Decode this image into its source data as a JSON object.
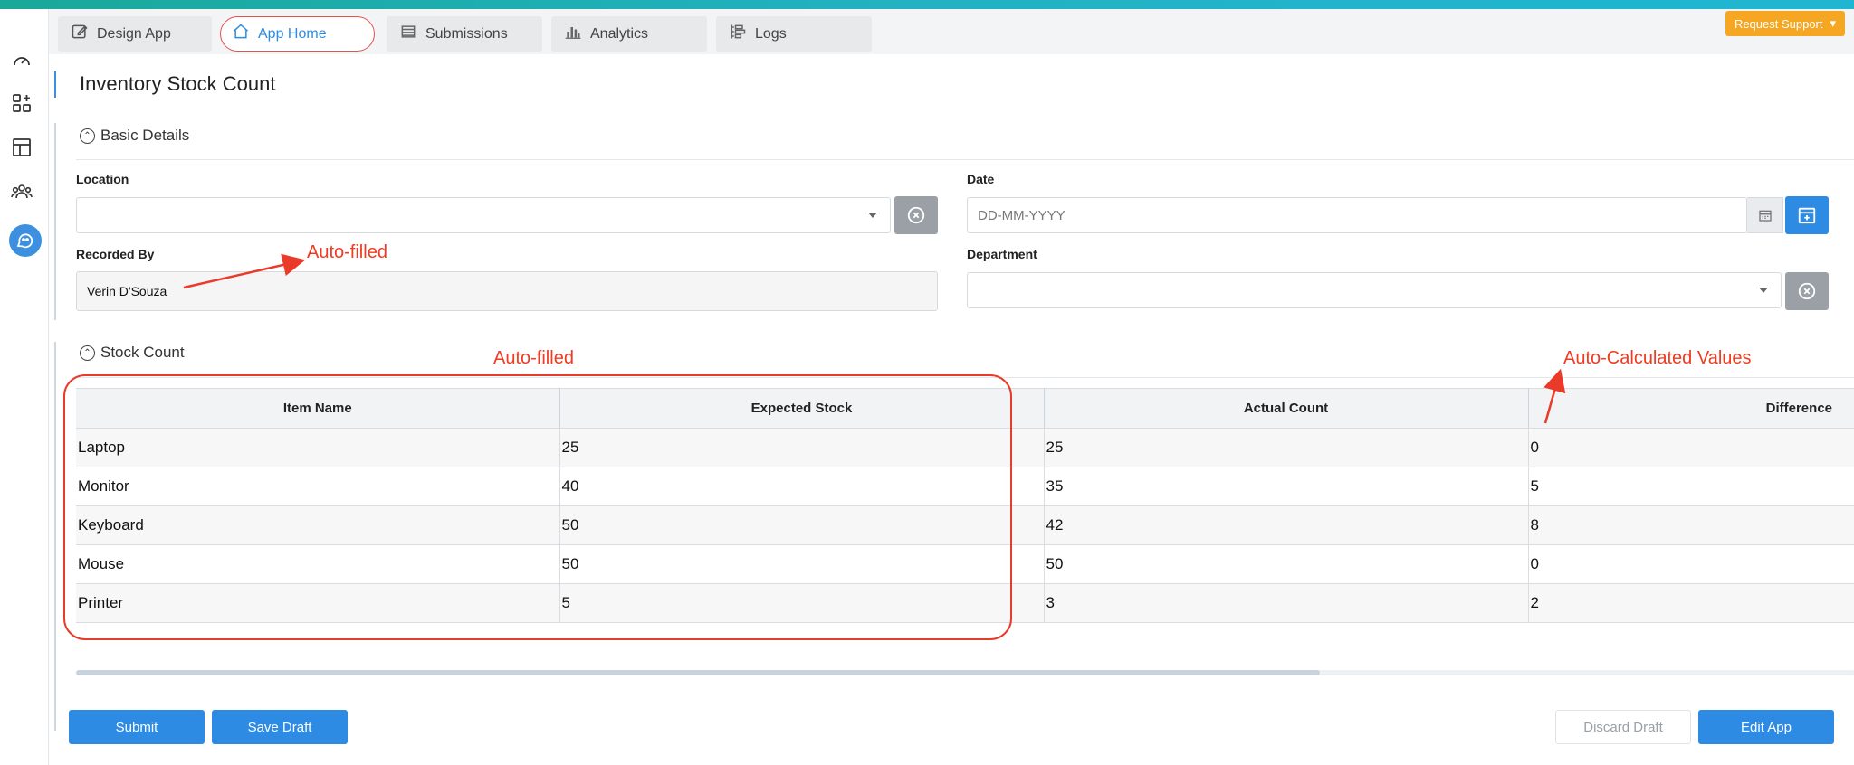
{
  "tabs": [
    {
      "label": "Design App",
      "icon": "edit-icon"
    },
    {
      "label": "App Home",
      "icon": "home-icon"
    },
    {
      "label": "Submissions",
      "icon": "table-icon"
    },
    {
      "label": "Analytics",
      "icon": "bar-chart-icon"
    },
    {
      "label": "Logs",
      "icon": "logs-icon"
    }
  ],
  "header": {
    "support_label": "Request Support"
  },
  "page": {
    "title": "Inventory Stock Count"
  },
  "basic_details": {
    "heading": "Basic Details",
    "location_label": "Location",
    "location_value": "",
    "date_label": "Date",
    "date_placeholder": "DD-MM-YYYY",
    "recorded_by_label": "Recorded By",
    "recorded_by_value": "Verin D'Souza",
    "department_label": "Department",
    "department_value": ""
  },
  "stock_count": {
    "heading": "Stock Count",
    "columns": [
      "Item Name",
      "Expected Stock",
      "Actual Count",
      "Difference"
    ],
    "rows": [
      [
        "Laptop",
        "25",
        "25",
        "0"
      ],
      [
        "Monitor",
        "40",
        "35",
        "5"
      ],
      [
        "Keyboard",
        "50",
        "42",
        "8"
      ],
      [
        "Mouse",
        "50",
        "50",
        "0"
      ],
      [
        "Printer",
        "5",
        "3",
        "2"
      ]
    ]
  },
  "footer": {
    "submit_label": "Submit",
    "save_draft_label": "Save Draft",
    "discard_draft_label": "Discard Draft",
    "edit_app_label": "Edit App"
  },
  "annotations": {
    "recorded_by_note": "Auto-filled",
    "table_note": "Auto-filled",
    "difference_note": "Auto-Calculated Values"
  },
  "colors": {
    "accent": "#2d8be3",
    "support": "#f5a623",
    "annotation": "#f03b20"
  }
}
